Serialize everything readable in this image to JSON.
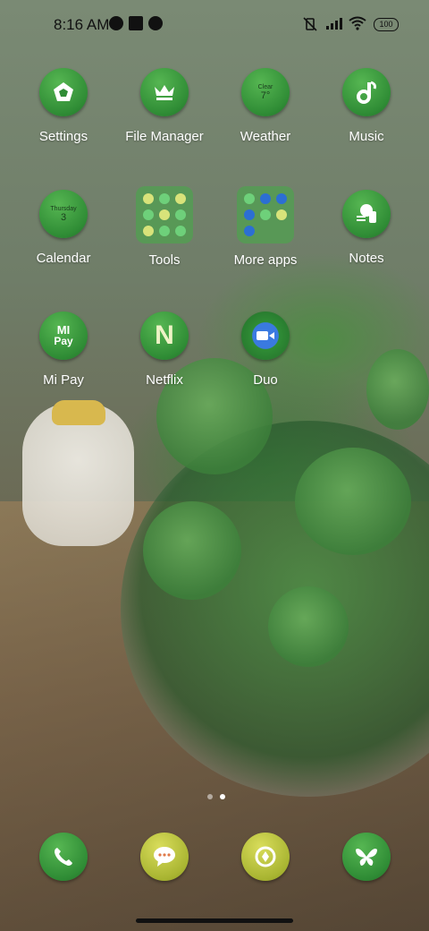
{
  "status_bar": {
    "time": "8:16 AM",
    "battery": "100"
  },
  "apps": {
    "row1": [
      {
        "label": "Settings",
        "icon": "settings-icon"
      },
      {
        "label": "File Manager",
        "icon": "crown-icon"
      },
      {
        "label": "Weather",
        "icon": "weather-icon",
        "weather_condition": "Clear",
        "weather_temp": "7°"
      },
      {
        "label": "Music",
        "icon": "music-note-icon"
      }
    ],
    "row2": [
      {
        "label": "Calendar",
        "icon": "calendar-icon",
        "calendar_day": "Thursday",
        "calendar_date": "3"
      },
      {
        "label": "Tools",
        "icon": "folder-icon"
      },
      {
        "label": "More apps",
        "icon": "folder-icon"
      },
      {
        "label": "Notes",
        "icon": "notes-icon"
      }
    ],
    "row3": [
      {
        "label": "Mi Pay",
        "icon": "mi-pay-icon",
        "badge_top": "MI",
        "badge_bottom": "Pay"
      },
      {
        "label": "Netflix",
        "icon": "netflix-icon",
        "glyph": "N"
      },
      {
        "label": "Duo",
        "icon": "video-call-icon"
      }
    ]
  },
  "dock": [
    {
      "name": "phone",
      "icon": "phone-icon"
    },
    {
      "name": "messages",
      "icon": "chat-icon"
    },
    {
      "name": "sync",
      "icon": "sync-icon"
    },
    {
      "name": "themes",
      "icon": "butterfly-icon"
    }
  ]
}
